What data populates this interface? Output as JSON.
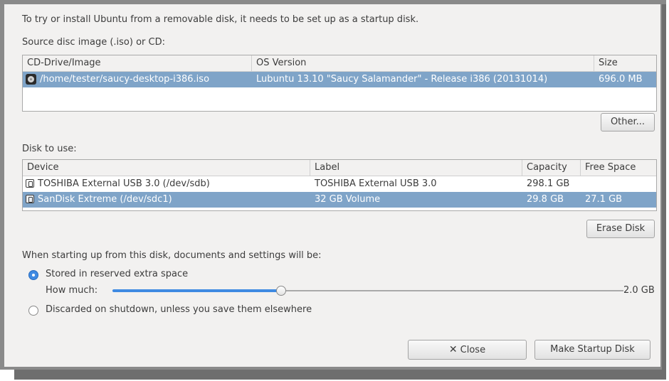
{
  "intro": "To try or install Ubuntu from a removable disk, it needs to be set up as a startup disk.",
  "source": {
    "label": "Source disc image (.iso) or CD:",
    "columns": [
      "CD-Drive/Image",
      "OS Version",
      "Size"
    ],
    "rows": [
      {
        "image": "/home/tester/saucy-desktop-i386.iso",
        "os_version": "Lubuntu 13.10 \"Saucy Salamander\" - Release i386 (20131014)",
        "size": "696.0 MB",
        "icon": "cd-image-icon",
        "selected": true
      }
    ],
    "other_button": "Other..."
  },
  "disk": {
    "label": "Disk to use:",
    "columns": [
      "Device",
      "Label",
      "Capacity",
      "Free Space"
    ],
    "rows": [
      {
        "device": "TOSHIBA External USB 3.0 (/dev/sdb)",
        "label": "TOSHIBA External USB 3.0",
        "capacity": "298.1 GB",
        "free": "",
        "icon": "usb-drive-icon",
        "selected": false
      },
      {
        "device": "SanDisk Extreme (/dev/sdc1)",
        "label": "32 GB Volume",
        "capacity": "29.8 GB",
        "free": "27.1 GB",
        "icon": "usb-drive-icon",
        "selected": true
      }
    ],
    "erase_button": "Erase Disk"
  },
  "persistence": {
    "heading": "When starting up from this disk, documents and settings will be:",
    "option_stored": "Stored in reserved extra space",
    "option_discarded": "Discarded on shutdown, unless you save them elsewhere",
    "selected_option": "stored",
    "how_much_label": "How much:",
    "amount_value": "2.0 GB",
    "slider_fraction": 0.33
  },
  "buttons": {
    "close_icon": "x-icon",
    "close": "Close",
    "make": "Make Startup Disk"
  },
  "colors": {
    "selection": "#7fa4c8",
    "accent": "#3f8ae2"
  }
}
